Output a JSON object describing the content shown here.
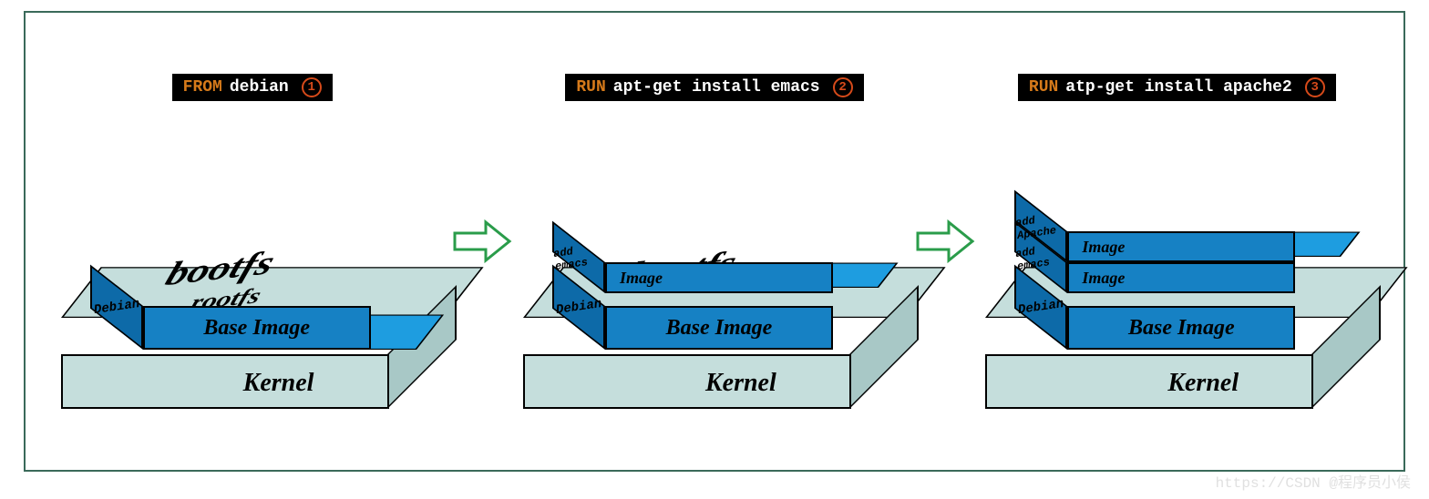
{
  "commands": [
    {
      "keyword": "FROM",
      "text": "debian",
      "num": "1"
    },
    {
      "keyword": "RUN",
      "text": "apt-get install emacs",
      "num": "2"
    },
    {
      "keyword": "RUN",
      "text": "atp-get install apache2",
      "num": "3"
    }
  ],
  "platform": {
    "top": "bootfs",
    "front": "Kernel"
  },
  "stacks": [
    {
      "layers": [
        {
          "left": "Debian",
          "front": "Base Image",
          "top": "rootfs",
          "thin": false
        }
      ]
    },
    {
      "layers": [
        {
          "left": "Debian",
          "front": "Base Image",
          "top": "",
          "thin": false
        },
        {
          "left": "add emacs",
          "front": "Image",
          "top": "",
          "thin": true
        }
      ]
    },
    {
      "layers": [
        {
          "left": "Debian",
          "front": "Base Image",
          "top": "",
          "thin": false
        },
        {
          "left": "add emacs",
          "front": "Image",
          "top": "",
          "thin": true
        },
        {
          "left": "add Apache",
          "front": "Image",
          "top": "",
          "thin": true
        }
      ]
    }
  ],
  "watermark": "https://CSDN @程序员小侯"
}
